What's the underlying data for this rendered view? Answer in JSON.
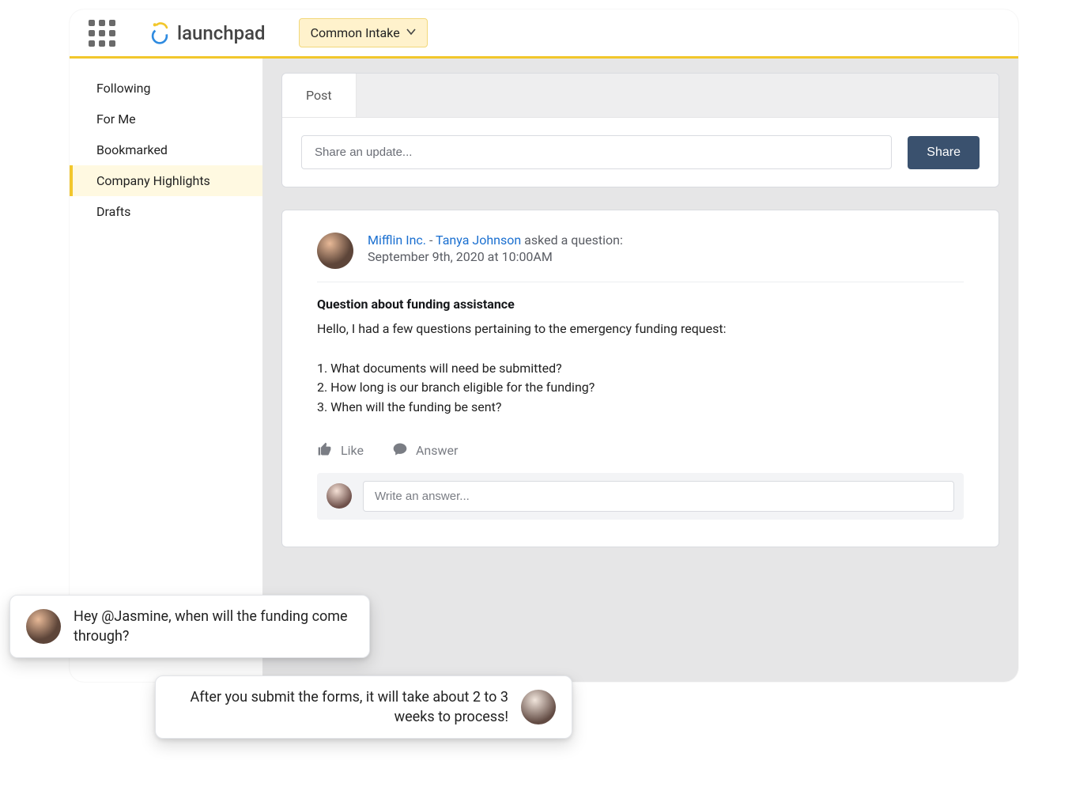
{
  "header": {
    "logo_text": "launchpad",
    "nav_pill_label": "Common Intake"
  },
  "sidebar": {
    "items": [
      {
        "label": "Following",
        "active": false
      },
      {
        "label": "For Me",
        "active": false
      },
      {
        "label": "Bookmarked",
        "active": false
      },
      {
        "label": "Company Highlights",
        "active": true
      },
      {
        "label": "Drafts",
        "active": false
      }
    ]
  },
  "composer": {
    "tab_label": "Post",
    "input_placeholder": "Share an update...",
    "button_label": "Share"
  },
  "post": {
    "author_org": "Mifflin Inc.",
    "author_separator": " - ",
    "author_name": "Tanya Johnson",
    "action_suffix": " asked a question:",
    "timestamp": "September 9th, 2020 at 10:00AM",
    "title": "Question about funding assistance",
    "body": "Hello, I had a few questions pertaining to the emergency funding request:\n\n1. What documents will need be submitted?\n2. How long is our branch eligible for the funding?\n3. When will the funding be sent?",
    "actions": {
      "like_label": "Like",
      "answer_label": "Answer"
    },
    "answer_placeholder": "Write an answer..."
  },
  "chat": {
    "msg1": "Hey @Jasmine, when will the funding come through?",
    "msg2": "After you submit the forms, it will take about 2 to 3 weeks to process!"
  }
}
